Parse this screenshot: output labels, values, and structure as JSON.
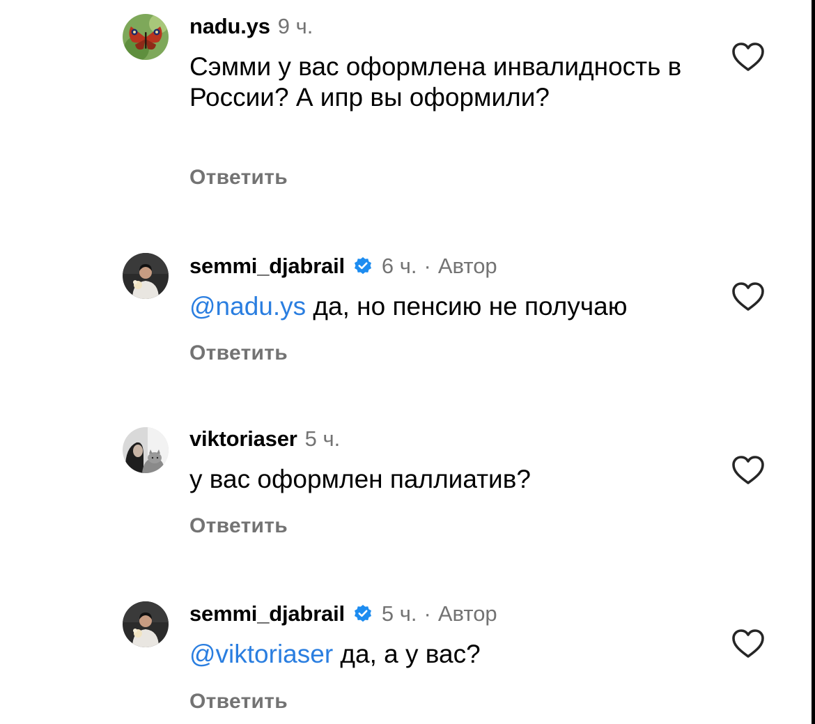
{
  "comments": [
    {
      "username": "nadu.ys",
      "verified": false,
      "time": "9 ч.",
      "mention": "",
      "text": "Сэмми у вас оформлена инвалидность в России? А ипр вы оформили?",
      "reply_label": "Ответить",
      "avatar": "butterfly-avatar"
    },
    {
      "username": "semmi_djabrail",
      "verified": true,
      "time": "6 ч.",
      "separator": "·",
      "author_label": "Автор",
      "mention": "@nadu.ys",
      "text": " да, но пенсию не получаю",
      "reply_label": "Ответить",
      "avatar": "person-dark-avatar"
    },
    {
      "username": "viktoriaser",
      "verified": false,
      "time": "5 ч.",
      "mention": "",
      "text": "у вас оформлен паллиатив?",
      "reply_label": "Ответить",
      "avatar": "person-with-cat-avatar"
    },
    {
      "username": "semmi_djabrail",
      "verified": true,
      "time": "5 ч.",
      "separator": "·",
      "author_label": "Автор",
      "mention": "@viktoriaser",
      "text": " да, а у вас?",
      "reply_label": "Ответить",
      "avatar": "person-dark-avatar"
    }
  ],
  "colors": {
    "mention": "#2a7ee0",
    "secondary_text": "#737373",
    "verified_badge": "#1d8cf0",
    "like_outline": "#262626"
  },
  "icons": {
    "like": "heart-outline-icon",
    "verified": "verified-badge-icon"
  }
}
